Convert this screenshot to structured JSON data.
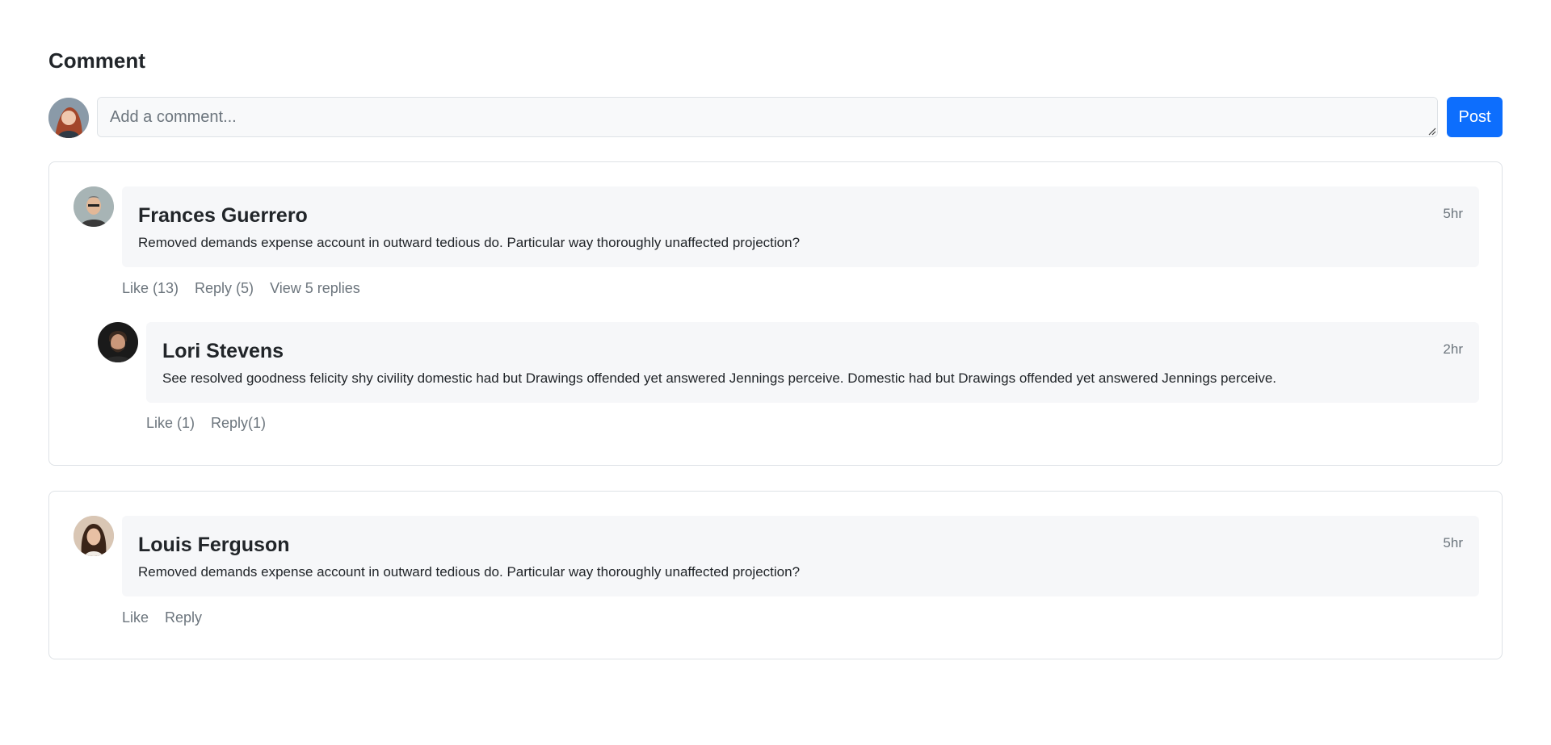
{
  "header": {
    "title": "Comment"
  },
  "composer": {
    "placeholder": "Add a comment...",
    "value": "",
    "post_label": "Post"
  },
  "comments": [
    {
      "author": "Frances Guerrero",
      "time": "5hr",
      "text": "Removed demands expense account in outward tedious do. Particular way thoroughly unaffected projection?",
      "actions": {
        "like": "Like (13)",
        "reply": "Reply (5)",
        "view": "View 5 replies"
      },
      "replies": [
        {
          "author": "Lori Stevens",
          "time": "2hr",
          "text": "See resolved goodness felicity shy civility domestic had but Drawings offended yet answered Jennings perceive. Domestic had but Drawings offended yet answered Jennings perceive.",
          "actions": {
            "like": "Like (1)",
            "reply": "Reply(1)"
          }
        }
      ]
    },
    {
      "author": "Louis Ferguson",
      "time": "5hr",
      "text": "Removed demands expense account in outward tedious do. Particular way thoroughly unaffected projection?",
      "actions": {
        "like": "Like",
        "reply": "Reply"
      }
    }
  ],
  "icons": {
    "avatar_current_user": "user-avatar-icon",
    "resize": "resize-grip-icon"
  },
  "colors": {
    "accent": "#0d6efd",
    "bubble": "#f6f7f9",
    "muted": "#6c757d",
    "border": "#dee2e6"
  }
}
